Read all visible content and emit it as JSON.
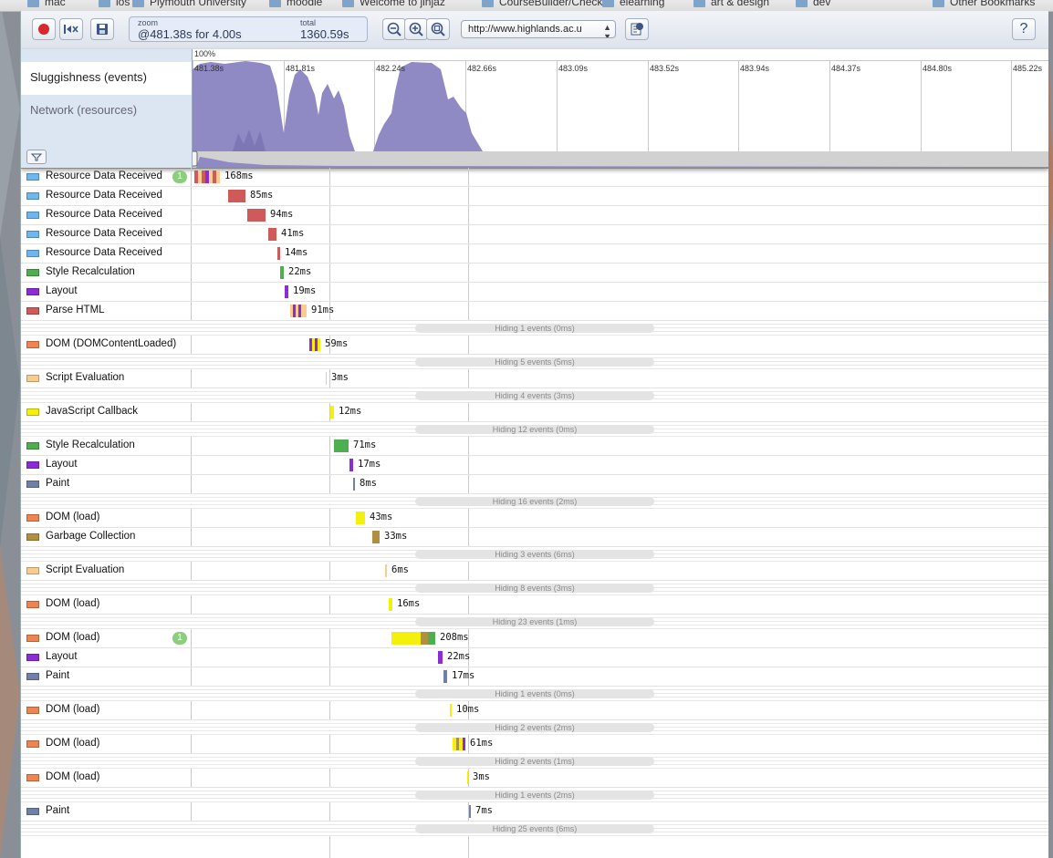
{
  "bookmarks": [
    "mac",
    "ios",
    "Plymouth University",
    "moodle",
    "Welcome to jinjaz",
    "CourseBuilder/Check",
    "elearning",
    "art & design",
    "dev",
    "Other Bookmarks"
  ],
  "toolbar": {
    "record_icon": "record-icon",
    "clear_icon": "clear-icon",
    "save_icon": "save-icon",
    "zoom_label": "zoom",
    "zoom_value": "@481.38s for 4.00s",
    "total_label": "total",
    "total_value": "1360.59s",
    "url": "http://www.highlands.ac.u",
    "help_label": "?",
    "accent": "#d9272e"
  },
  "overview": {
    "percent": "100%",
    "rows": [
      "Sluggishness (events)",
      "Network (resources)"
    ],
    "ticks": [
      "481.38s",
      "481.81s",
      "482.24s",
      "482.66s",
      "483.09s",
      "483.52s",
      "483.94s",
      "484.37s",
      "484.80s",
      "485.22s"
    ],
    "graph_color": "#8f89c4"
  },
  "colors": {
    "loading": "#6db6ef",
    "style": "#4daf4f",
    "layout": "#8b2dd6",
    "parse": "#cf5a5a",
    "dom": "#ee8450",
    "script": "#f8cc8f",
    "callback": "#f4f00c",
    "paint": "#7180a7",
    "gc": "#b09040"
  },
  "records": [
    {
      "type": "row",
      "name": "Resource Data Received",
      "color": "loading",
      "badge": "1",
      "bar": [
        190,
        28
      ],
      "segs": [
        "#cf5a5a",
        "#f8cc8f",
        "#cf5a5a",
        "#8b2dd6",
        "#f8cc8f",
        "#cf5a5a",
        "#f8cc8f"
      ],
      "dur": "168ms"
    },
    {
      "type": "row",
      "name": "Resource Data Received",
      "color": "loading",
      "bar": [
        227,
        19
      ],
      "seg": "#cf5a5a",
      "dur": "85ms"
    },
    {
      "type": "row",
      "name": "Resource Data Received",
      "color": "loading",
      "bar": [
        248,
        20
      ],
      "seg": "#cf5a5a",
      "dur": "94ms"
    },
    {
      "type": "row",
      "name": "Resource Data Received",
      "color": "loading",
      "bar": [
        271,
        9
      ],
      "seg": "#cf5a5a",
      "dur": "41ms"
    },
    {
      "type": "row",
      "name": "Resource Data Received",
      "color": "loading",
      "bar": [
        281,
        3
      ],
      "seg": "#cf5a5a",
      "dur": "14ms"
    },
    {
      "type": "row",
      "name": "Style Recalculation",
      "color": "style",
      "bar": [
        284,
        4
      ],
      "seg": "#4daf4f",
      "dur": "22ms"
    },
    {
      "type": "row",
      "name": "Layout",
      "color": "layout",
      "bar": [
        289,
        4
      ],
      "seg": "#8b2dd6",
      "dur": "19ms"
    },
    {
      "type": "row",
      "name": "Parse HTML",
      "color": "parse",
      "bar": [
        295,
        18
      ],
      "segs": [
        "#f8cc8f",
        "#8b2dd6",
        "#f8cc8f",
        "#8b2dd6",
        "#f8cc8f",
        "#f8cc8f"
      ],
      "dur": "91ms"
    },
    {
      "type": "hidden",
      "text": "Hiding 1 events (0ms)"
    },
    {
      "type": "row",
      "name": "DOM (DOMContentLoaded)",
      "color": "dom",
      "bar": [
        316,
        12
      ],
      "segs": [
        "#8b2dd6",
        "#f4f00c",
        "#8b2dd6",
        "#f4f00c"
      ],
      "dur": "59ms"
    },
    {
      "type": "hidden",
      "text": "Hiding 5 events (5ms)"
    },
    {
      "type": "row",
      "name": "Script Evaluation",
      "color": "script",
      "bar": [
        334,
        1
      ],
      "seg": "#f8cc8f",
      "dur": "3ms"
    },
    {
      "type": "hidden",
      "text": "Hiding 4 events (3ms)"
    },
    {
      "type": "row",
      "name": "JavaScript Callback",
      "color": "callback",
      "bar": [
        339,
        4
      ],
      "seg": "#f4f00c",
      "dur": "12ms"
    },
    {
      "type": "hidden",
      "text": "Hiding 12 events (0ms)"
    },
    {
      "type": "row",
      "name": "Style Recalculation",
      "color": "style",
      "bar": [
        343,
        16
      ],
      "seg": "#4daf4f",
      "dur": "71ms"
    },
    {
      "type": "row",
      "name": "Layout",
      "color": "layout",
      "bar": [
        360,
        4
      ],
      "seg": "#8b2dd6",
      "dur": "17ms"
    },
    {
      "type": "row",
      "name": "Paint",
      "color": "paint",
      "bar": [
        364,
        2
      ],
      "seg": "#7180a7",
      "dur": "8ms"
    },
    {
      "type": "hidden",
      "text": "Hiding 16 events (2ms)"
    },
    {
      "type": "row",
      "name": "DOM (load)",
      "color": "dom",
      "bar": [
        367,
        10
      ],
      "seg": "#f4f00c",
      "dur": "43ms"
    },
    {
      "type": "row",
      "name": "Garbage Collection",
      "color": "gc",
      "bar": [
        385,
        8
      ],
      "seg": "#b09040",
      "dur": "33ms"
    },
    {
      "type": "hidden",
      "text": "Hiding 3 events (6ms)"
    },
    {
      "type": "row",
      "name": "Script Evaluation",
      "color": "script",
      "bar": [
        399,
        2
      ],
      "seg": "#f8cc8f",
      "dur": "6ms"
    },
    {
      "type": "hidden",
      "text": "Hiding 8 events (3ms)"
    },
    {
      "type": "row",
      "name": "DOM (load)",
      "color": "dom",
      "bar": [
        403,
        4
      ],
      "seg": "#f4f00c",
      "dur": "16ms"
    },
    {
      "type": "hidden",
      "text": "Hiding 23 events (1ms)"
    },
    {
      "type": "row",
      "name": "DOM (load)",
      "color": "dom",
      "badge": "1",
      "bar": [
        406,
        48
      ],
      "segs": [
        "#f4f00c",
        "#f4f00c",
        "#f4f00c",
        "#f4f00c",
        "#b09040",
        "#4daf4f"
      ],
      "dur": "208ms"
    },
    {
      "type": "row",
      "name": "Layout",
      "color": "layout",
      "bar": [
        457,
        5
      ],
      "seg": "#8b2dd6",
      "dur": "22ms"
    },
    {
      "type": "row",
      "name": "Paint",
      "color": "paint",
      "bar": [
        463,
        4
      ],
      "seg": "#7180a7",
      "dur": "17ms"
    },
    {
      "type": "hidden",
      "text": "Hiding 1 events (0ms)"
    },
    {
      "type": "row",
      "name": "DOM (load)",
      "color": "dom",
      "bar": [
        470,
        2
      ],
      "seg": "#f4f00c",
      "dur": "10ms"
    },
    {
      "type": "hidden",
      "text": "Hiding 2 events (2ms)"
    },
    {
      "type": "row",
      "name": "DOM (load)",
      "color": "dom",
      "bar": [
        473,
        14
      ],
      "segs": [
        "#f4f00c",
        "#b09040",
        "#f4f00c",
        "#8b2dd6"
      ],
      "dur": "61ms"
    },
    {
      "type": "hidden",
      "text": "Hiding 2 events (1ms)"
    },
    {
      "type": "row",
      "name": "DOM (load)",
      "color": "dom",
      "bar": [
        489,
        1
      ],
      "seg": "#f4f00c",
      "dur": "3ms"
    },
    {
      "type": "hidden",
      "text": "Hiding 1 events (2ms)"
    },
    {
      "type": "row",
      "name": "Paint",
      "color": "paint",
      "bar": [
        491,
        2
      ],
      "seg": "#7180a7",
      "dur": "7ms"
    },
    {
      "type": "hidden",
      "text": "Hiding 25 events (6ms)"
    }
  ]
}
